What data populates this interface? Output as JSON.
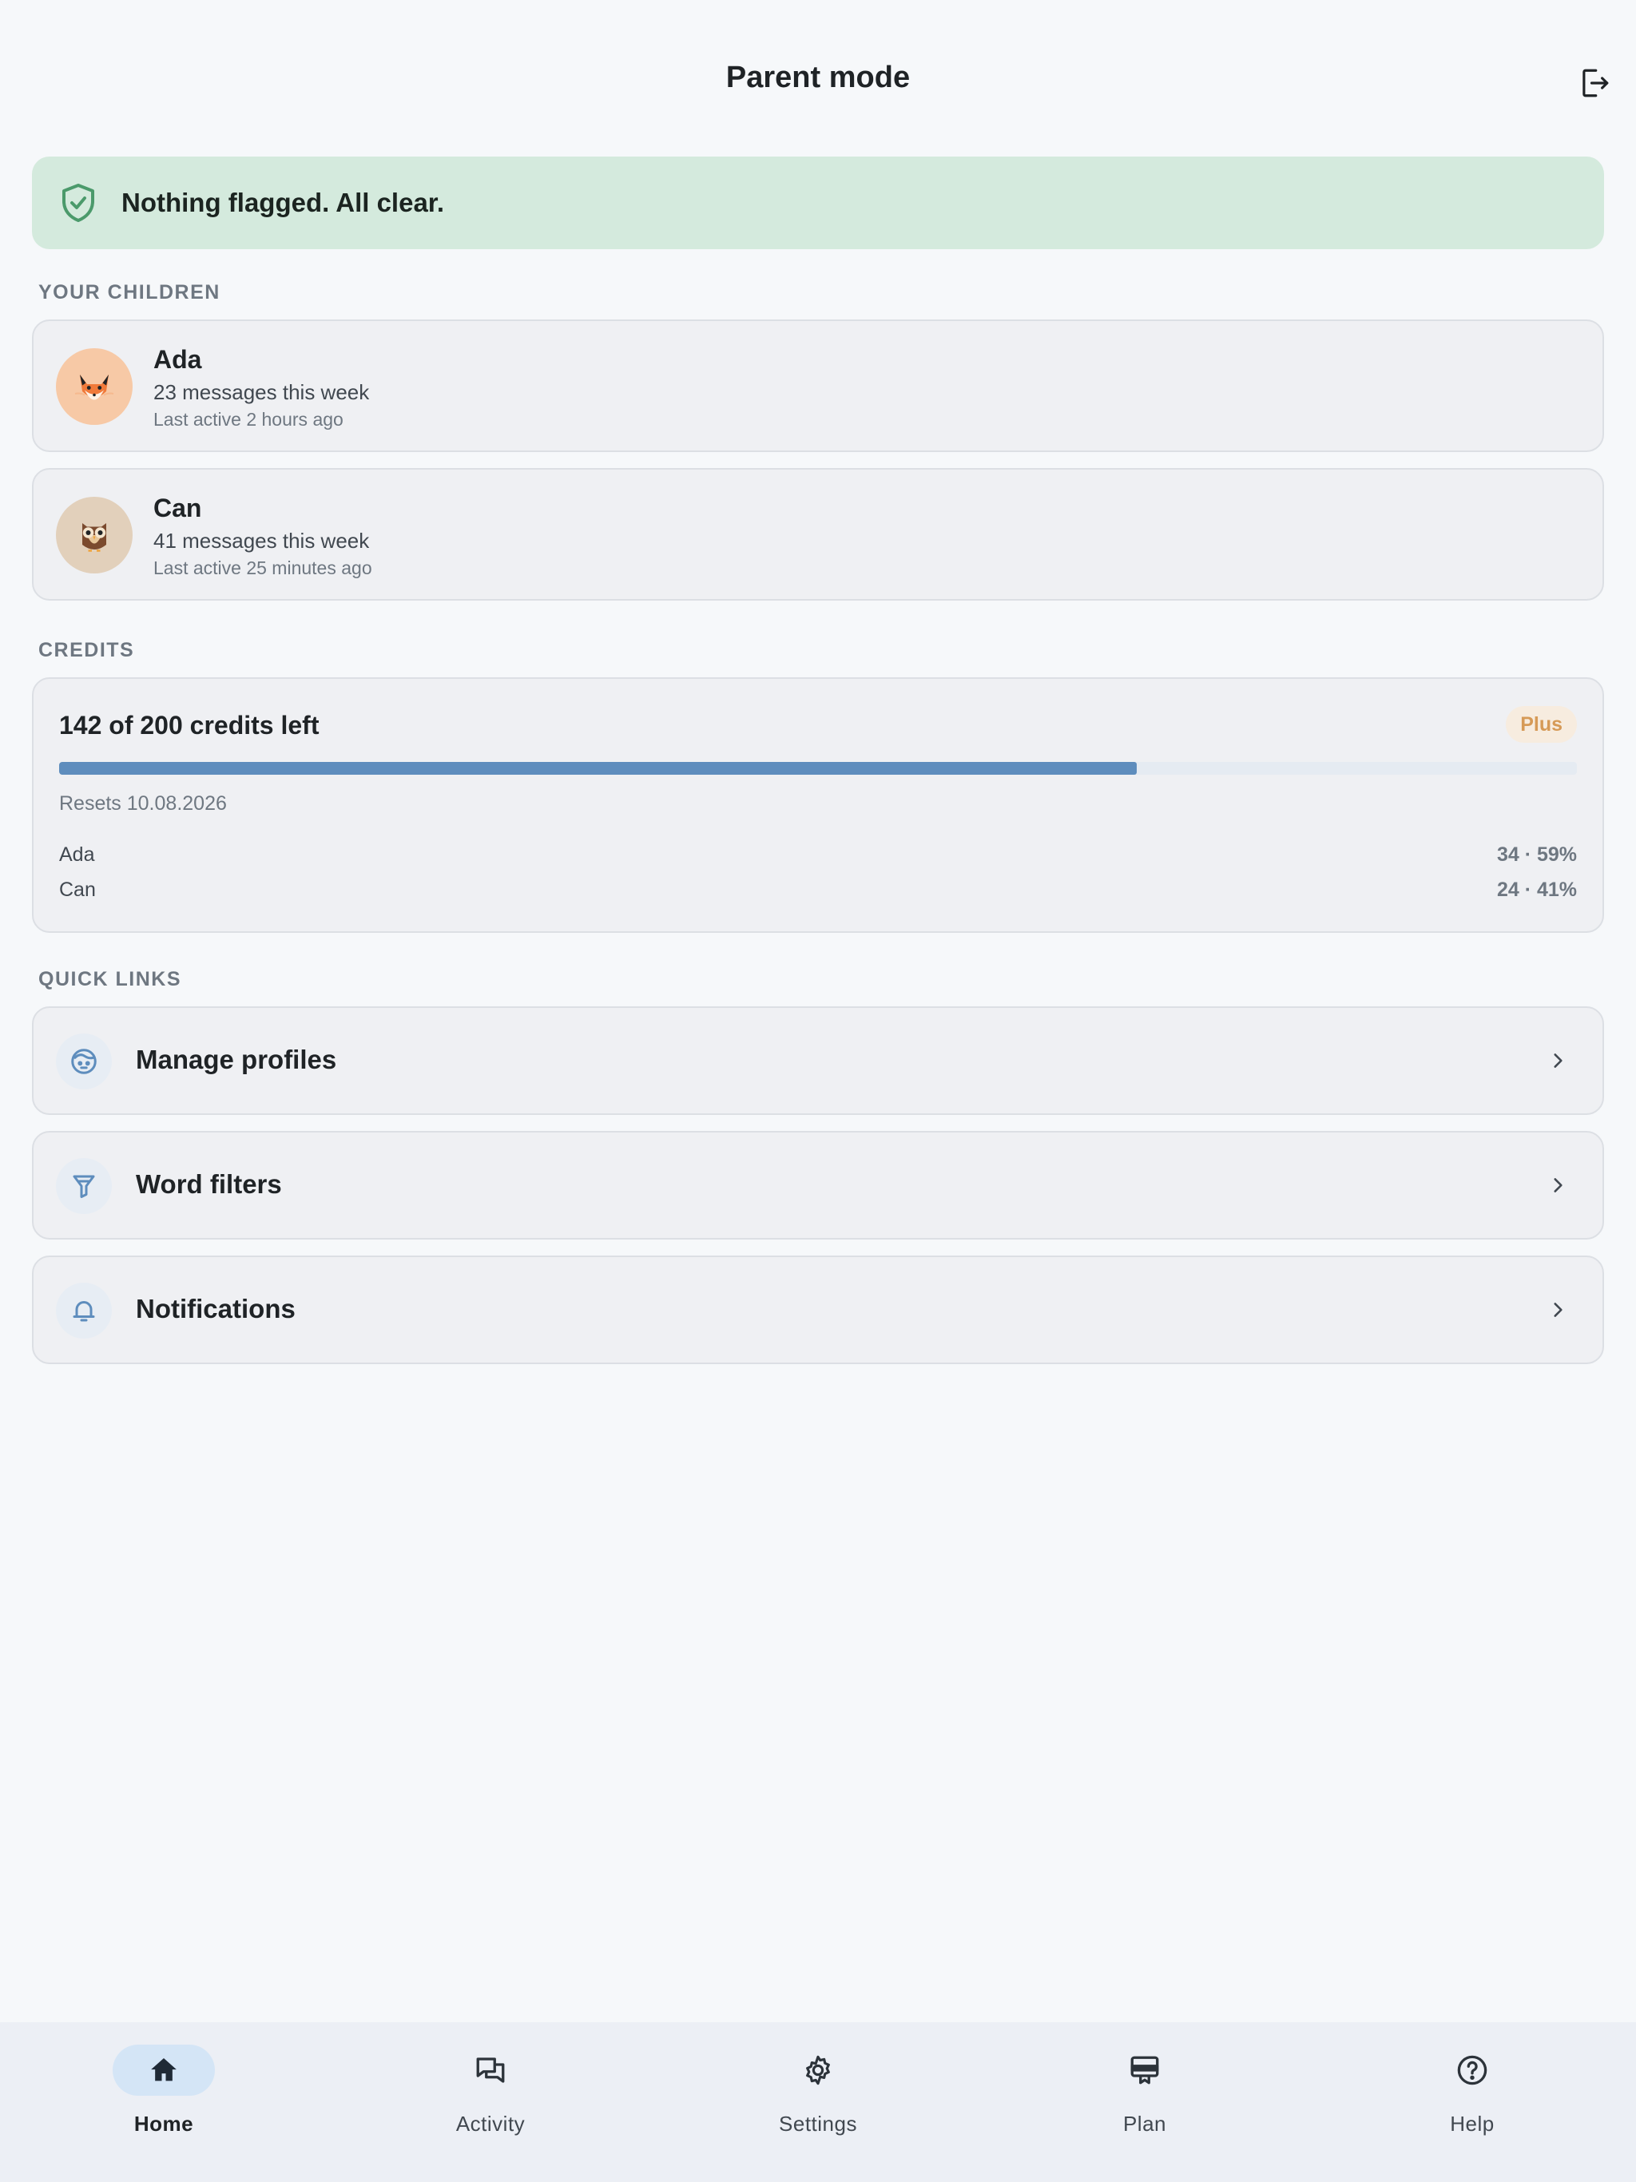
{
  "header": {
    "title": "Parent mode",
    "logout_icon": "logout-icon"
  },
  "banner": {
    "text": "Nothing flagged. All clear.",
    "icon": "shield-check-icon",
    "color": "#d4eadd"
  },
  "children_section": {
    "label": "YOUR CHILDREN",
    "children": [
      {
        "name": "Ada",
        "messages": "23 messages this week",
        "last_active": "Last active 2 hours ago",
        "avatar": "fox-avatar",
        "avatar_bg": "#f7c9a6"
      },
      {
        "name": "Can",
        "messages": "41 messages this week",
        "last_active": "Last active 25 minutes ago",
        "avatar": "owl-avatar",
        "avatar_bg": "#e2d0bb"
      }
    ]
  },
  "credits_section": {
    "label": "CREDITS",
    "summary": "142 of 200 credits left",
    "plan": "Plus",
    "remaining_fraction": 0.71,
    "resets": "Resets 10.08.2026",
    "usage": [
      {
        "name": "Ada",
        "value": "34 · 59%"
      },
      {
        "name": "Can",
        "value": "24 · 41%"
      }
    ],
    "accent": "#5e8dbd"
  },
  "quick_links": {
    "label": "QUICK LINKS",
    "items": [
      {
        "label": "Manage profiles",
        "icon": "face-icon"
      },
      {
        "label": "Word filters",
        "icon": "filter-icon"
      },
      {
        "label": "Notifications",
        "icon": "bell-icon"
      }
    ]
  },
  "nav": {
    "items": [
      {
        "label": "Home",
        "icon": "home-icon",
        "active": true
      },
      {
        "label": "Activity",
        "icon": "chat-icon",
        "active": false
      },
      {
        "label": "Settings",
        "icon": "gear-icon",
        "active": false
      },
      {
        "label": "Plan",
        "icon": "plan-icon",
        "active": false
      },
      {
        "label": "Help",
        "icon": "help-icon",
        "active": false
      }
    ]
  }
}
